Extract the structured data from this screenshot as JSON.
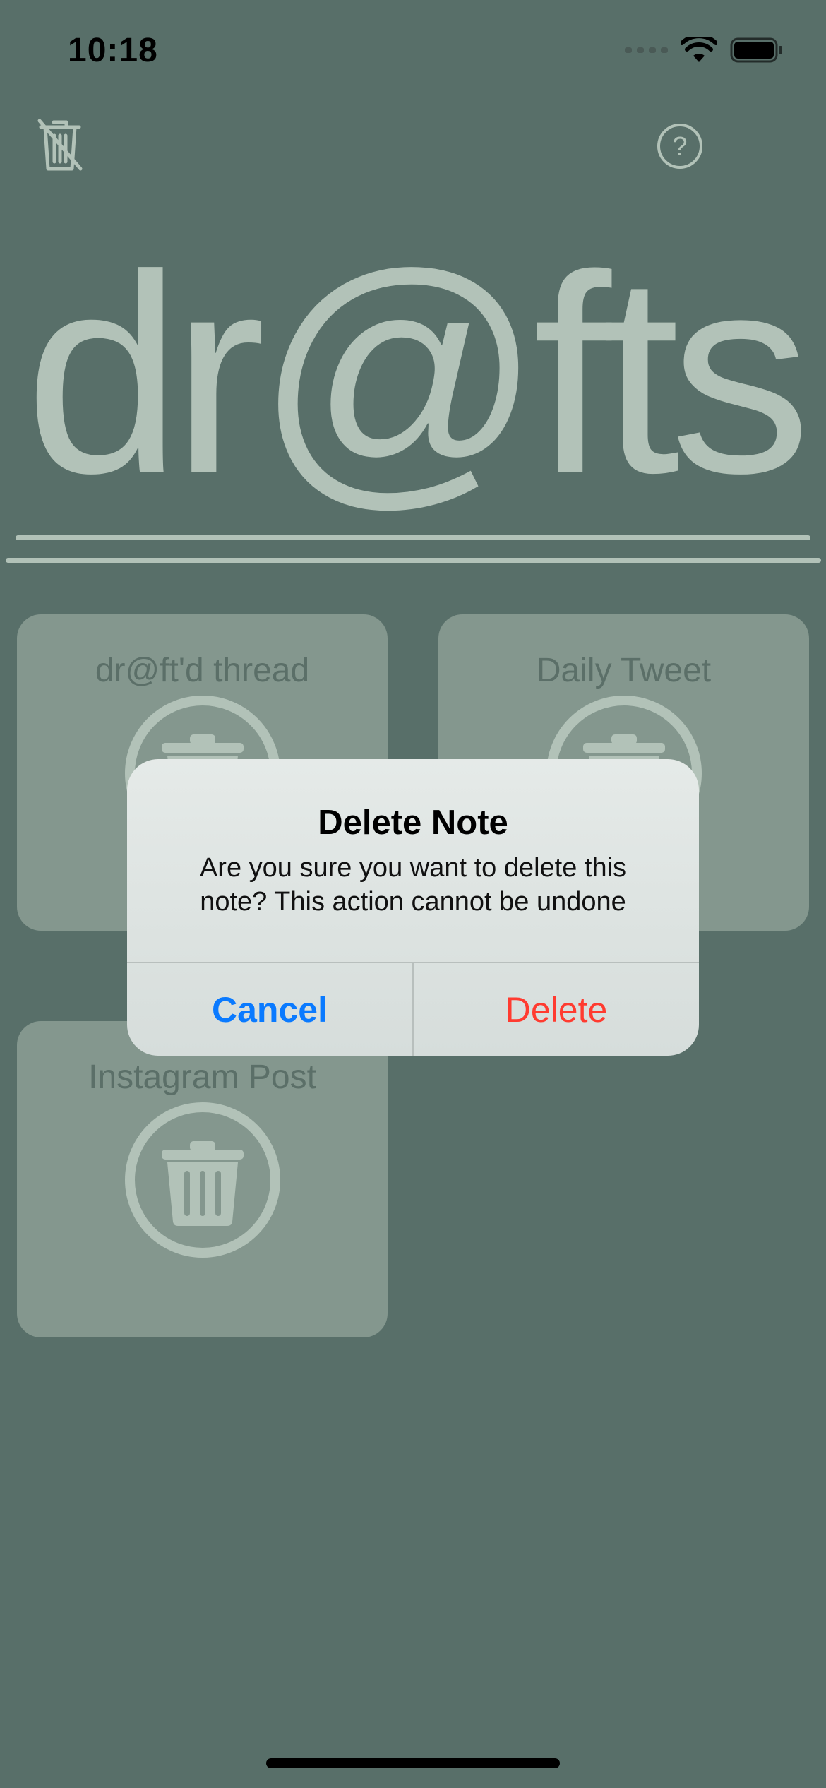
{
  "status_bar": {
    "time": "10:18"
  },
  "top_bar": {
    "left_icon": "trash-slash-icon",
    "right_icon": "help-circle-icon"
  },
  "logo": "dr@fts",
  "notes": [
    {
      "title": "dr@ft'd thread",
      "icon": "trash-icon"
    },
    {
      "title": "Daily Tweet",
      "icon": "trash-icon"
    },
    {
      "title": "Instagram Post",
      "icon": "trash-icon"
    }
  ],
  "alert": {
    "title": "Delete Note",
    "message": "Are you sure you want to delete this note? This action cannot be undone",
    "cancel_label": "Cancel",
    "delete_label": "Delete"
  },
  "colors": {
    "background": "#586f69",
    "accent": "#b2c2b8",
    "card": "#84978e",
    "cancel": "#0a7aff",
    "destructive": "#ff3b30"
  }
}
